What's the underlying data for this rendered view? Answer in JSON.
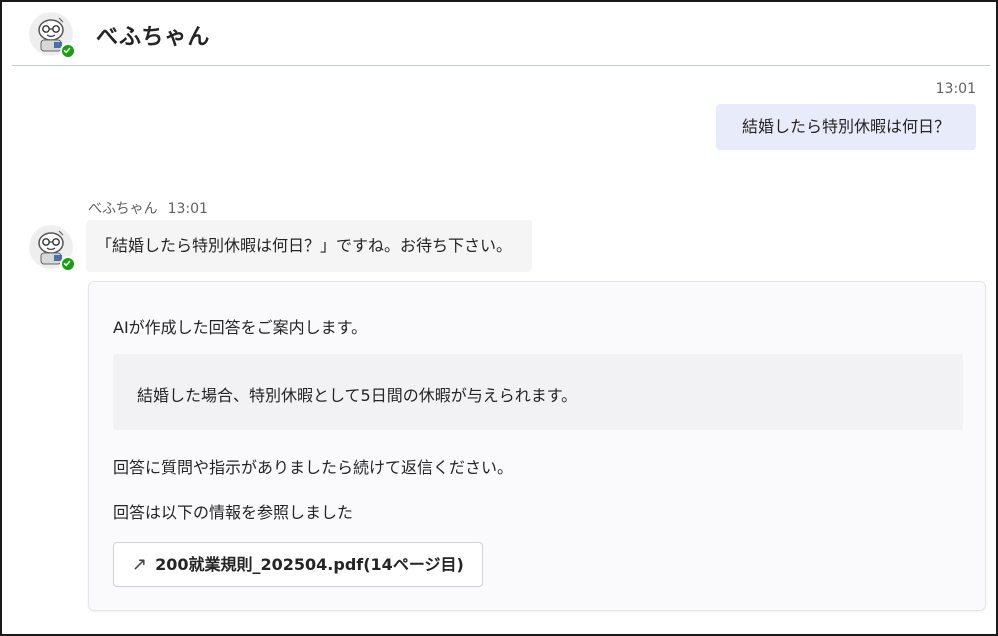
{
  "header": {
    "title": "べふちゃん",
    "avatar_icon": "robot-avatar-icon",
    "status_color": "#13a10e"
  },
  "sent_message": {
    "time": "13:01",
    "text": "結婚したら特別休暇は何日？"
  },
  "bot_message": {
    "sender": "べふちゃん",
    "time": "13:01",
    "text": "「結婚したら特別休暇は何日？」ですね。お待ち下さい。"
  },
  "answer_card": {
    "intro": "AIが作成した回答をご案内します。",
    "answer": "結婚した場合、特別休暇として5日間の休暇が与えられます。",
    "followup": "回答に質問や指示がありましたら続けて返信ください。",
    "reference_label": "回答は以下の情報を参照しました",
    "reference_button": {
      "icon": "↗",
      "label": "200就業規則_202504.pdf(14ページ目)"
    }
  },
  "colors": {
    "sent_bubble": "#e8ebfa",
    "bot_bubble": "#f5f5f5",
    "card_background": "#faf9fb"
  }
}
